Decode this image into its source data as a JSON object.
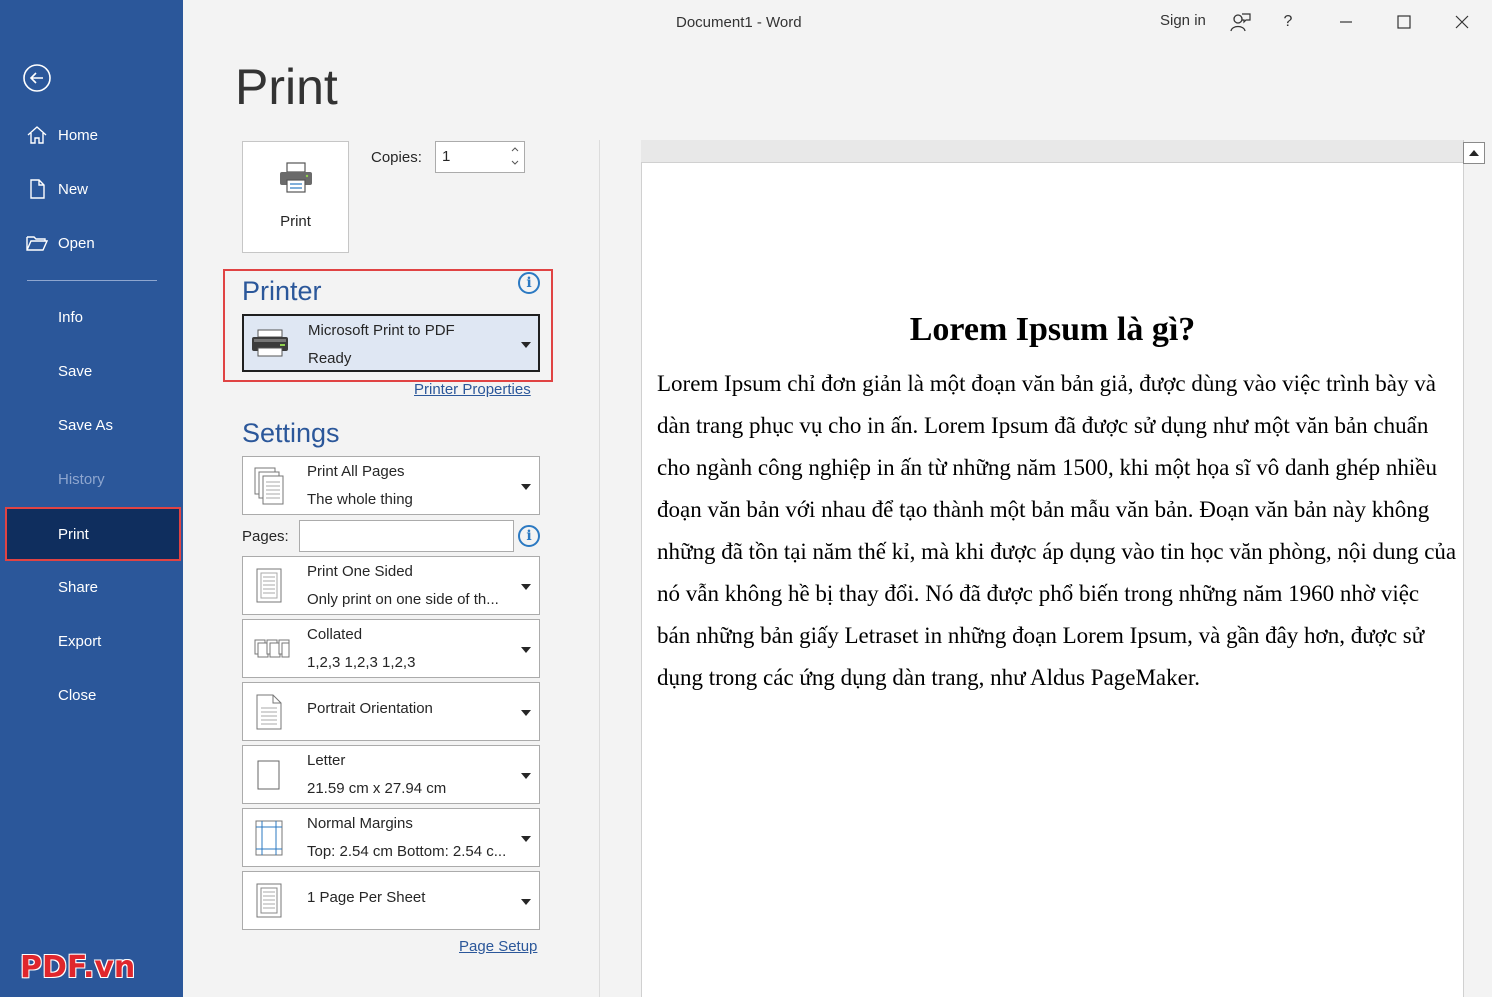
{
  "window": {
    "title": "Document1  -  Word",
    "sign_in": "Sign in",
    "help": "?"
  },
  "sidebar": {
    "items": [
      {
        "label": "Home",
        "icon": "home-icon"
      },
      {
        "label": "New",
        "icon": "new-document-icon"
      },
      {
        "label": "Open",
        "icon": "open-folder-icon"
      },
      {
        "label": "Info"
      },
      {
        "label": "Save"
      },
      {
        "label": "Save As"
      },
      {
        "label": "History",
        "state": "disabled"
      },
      {
        "label": "Print",
        "state": "active"
      },
      {
        "label": "Share"
      },
      {
        "label": "Export"
      },
      {
        "label": "Close"
      }
    ],
    "accent": "#2b579a",
    "active_bg": "#0f2e5e",
    "highlight": "#e04343"
  },
  "watermark": "PDF.vn",
  "print": {
    "heading": "Print",
    "button_label": "Print",
    "copies_label": "Copies:",
    "copies_value": "1",
    "printer_title": "Printer",
    "printer_name": "Microsoft Print to PDF",
    "printer_status": "Ready",
    "printer_properties": "Printer Properties",
    "settings_title": "Settings",
    "pages_label": "Pages:",
    "pages_value": "",
    "page_setup": "Page Setup",
    "settings": [
      {
        "l1": "Print All Pages",
        "l2": "The whole thing"
      },
      {
        "l1": "Print One Sided",
        "l2": "Only print on one side of th..."
      },
      {
        "l1": "Collated",
        "l2": "1,2,3    1,2,3    1,2,3"
      },
      {
        "l1": "Portrait Orientation"
      },
      {
        "l1": "Letter",
        "l2": "21.59 cm x 27.94 cm"
      },
      {
        "l1": "Normal Margins",
        "l2": "Top: 2.54 cm Bottom: 2.54 c..."
      },
      {
        "l1": "1 Page Per Sheet"
      }
    ]
  },
  "preview": {
    "heading": "Lorem Ipsum là gì?",
    "body": "Lorem Ipsum chỉ đơn giản là một đoạn văn bản giả, được dùng vào việc trình bày và dàn trang phục vụ cho in ấn. Lorem Ipsum đã được sử dụng như một văn bản chuẩn cho ngành công nghiệp in ấn từ những năm 1500, khi một họa sĩ vô danh ghép nhiều đoạn văn bản với nhau để tạo thành một bản mẫu văn bản. Đoạn văn bản này không những đã tồn tại năm thế kỉ, mà khi được áp dụng vào tin học văn phòng, nội dung của nó vẫn không hề bị thay đổi. Nó đã được phổ biến trong những năm 1960 nhờ việc bán những bản giấy Letraset in những đoạn Lorem Ipsum, và gần đây hơn, được sử dụng trong các ứng dụng dàn trang, như Aldus PageMaker."
  }
}
